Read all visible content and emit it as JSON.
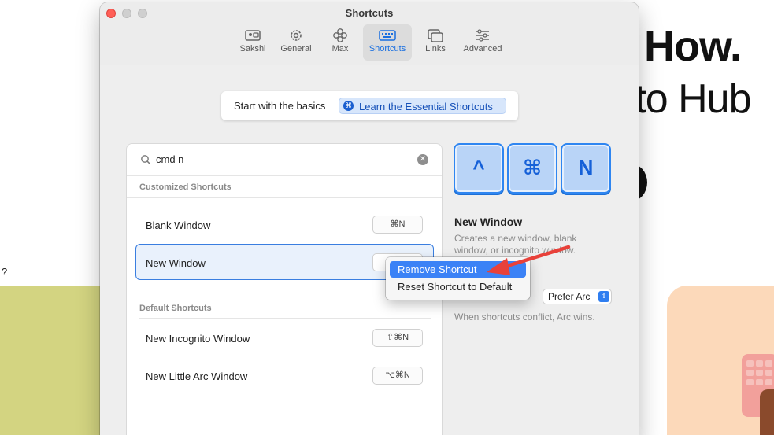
{
  "background": {
    "heading": "How.",
    "subheading": "-to Hub",
    "stray_text": "?"
  },
  "window": {
    "title": "Shortcuts",
    "tabs": [
      {
        "label": "Sakshi",
        "icon": "id-card-icon"
      },
      {
        "label": "General",
        "icon": "gear-icon"
      },
      {
        "label": "Max",
        "icon": "flower-icon"
      },
      {
        "label": "Shortcuts",
        "icon": "keyboard-icon",
        "active": true
      },
      {
        "label": "Links",
        "icon": "windows-icon"
      },
      {
        "label": "Advanced",
        "icon": "sliders-icon"
      }
    ]
  },
  "basics": {
    "text": "Start with the basics",
    "button": "Learn the Essential Shortcuts",
    "button_icon": "⌘"
  },
  "search": {
    "value": "cmd n",
    "clear_icon": "⊗"
  },
  "customized": {
    "header": "Customized Shortcuts",
    "rows": [
      {
        "label": "Blank Window",
        "keys": "⌘N"
      },
      {
        "label": "New Window",
        "keys": ""
      }
    ]
  },
  "defaults": {
    "header": "Default Shortcuts",
    "rows": [
      {
        "label": "New Incognito Window",
        "keys": "⇧⌘N"
      },
      {
        "label": "New Little Arc Window",
        "keys": "⌥⌘N"
      }
    ]
  },
  "detail": {
    "keys": [
      "^",
      "⌘",
      "N"
    ],
    "title": "New Window",
    "description": "Creates a new window, blank window, or incognito window.",
    "conflict_value": "Prefer Arc",
    "conflict_note": "When shortcuts conflict, Arc wins."
  },
  "context_menu": {
    "items": [
      "Remove Shortcut",
      "Reset Shortcut to Default"
    ],
    "highlighted": "Remove Shortcut"
  },
  "colors": {
    "accent": "#3b82f6",
    "annotation_arrow": "#e8413a",
    "key_cap": "#b9d4f7"
  }
}
